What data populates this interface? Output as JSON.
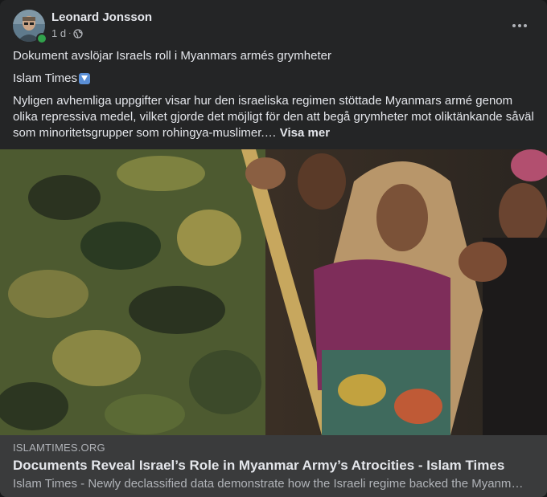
{
  "post": {
    "author": "Leonard Jonsson",
    "time": "1 d",
    "privacy_icon": "globe-icon",
    "more_icon": "more-options-icon",
    "headline": "Dokument avslöjar Israels roll i Myanmars armés grymheter",
    "source_line": "Islam Times",
    "source_emoji": "down-arrow-emoji",
    "body": "Nyligen avhemliga uppgifter visar hur den israeliska regimen stöttade Myanmars armé genom olika repressiva medel, vilket gjorde det möjligt för den att begå grymheter mot oliktänkande såväl som minoritetsgrupper som rohingya-muslimer.…",
    "see_more": "Visa mer"
  },
  "link": {
    "domain": "ISLAMTIMES.ORG",
    "title": "Documents Reveal Israel’s Role in Myanmar Army’s Atrocities - Islam Times",
    "description": "Islam Times - Newly declassified data demonstrate how the Israeli regime backed the Myanmar army through various repressive means, enabling it to commit atrocities"
  },
  "colors": {
    "card_bg": "#242526",
    "link_bg": "#3a3b3c",
    "online": "#31a24c"
  }
}
